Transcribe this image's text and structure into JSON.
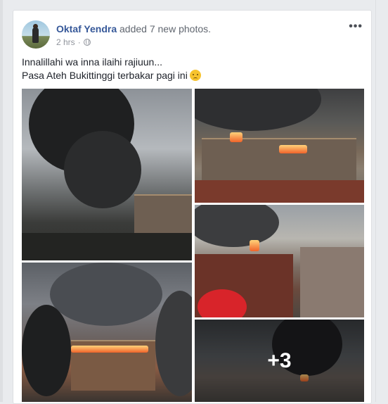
{
  "post": {
    "author": "Oktaf Yendra",
    "action": "added 7 new photos.",
    "time": "2 hrs",
    "separator": "·",
    "privacy_icon": "globe-icon",
    "options_icon": "more-options-icon",
    "options_label": "•••",
    "caption_line1": "Innalillahi wa inna ilaihi rajiuun...",
    "caption_line2": "Pasa Ateh Bukittinggi terbakar pagi ini",
    "caption_emoji": "sad-face-emoji"
  },
  "photos": {
    "more_count_label": "+3"
  },
  "colors": {
    "link": "#365899",
    "text": "#1d2129",
    "meta": "#90949c",
    "background": "#e9ebee"
  }
}
